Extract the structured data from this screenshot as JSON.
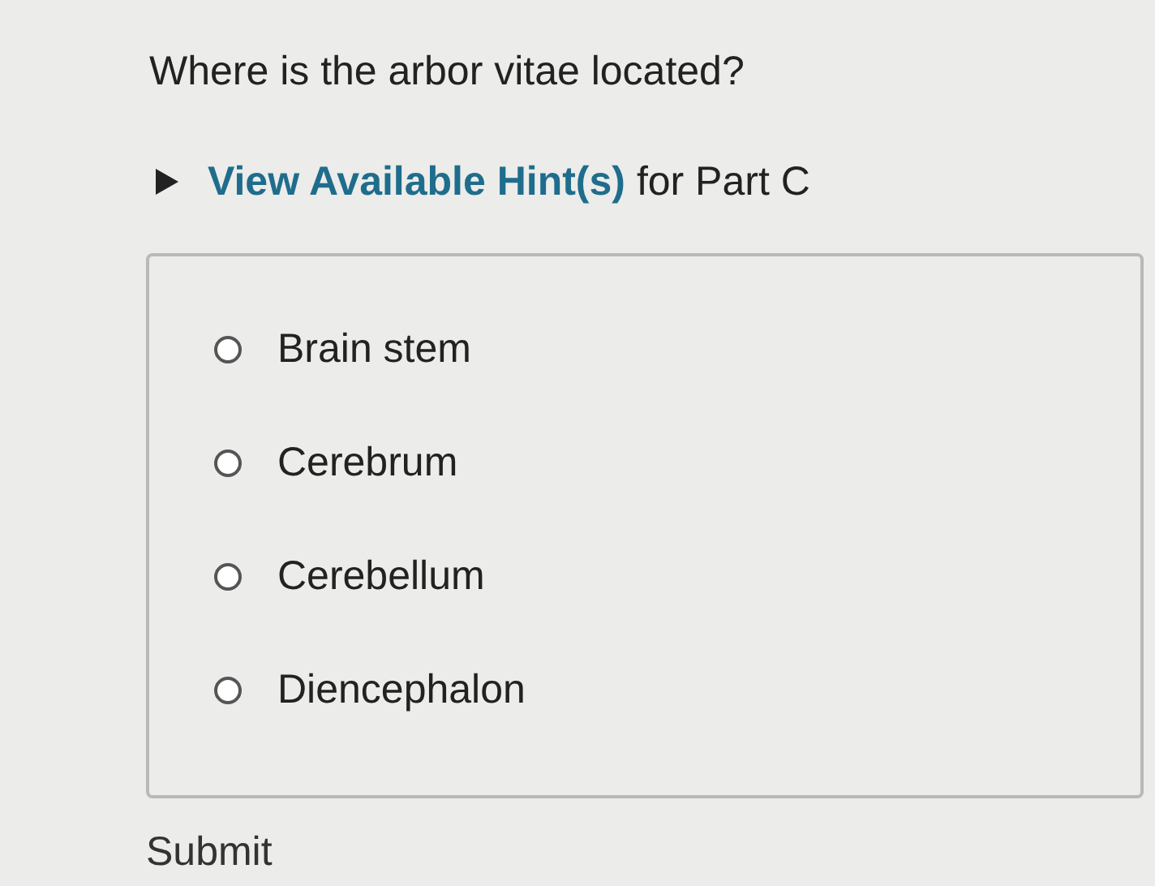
{
  "question": "Where is the arbor vitae located?",
  "hint": {
    "link": "View Available Hint(s)",
    "rest": "for Part C",
    "expanded": false
  },
  "options": [
    {
      "label": "Brain stem",
      "selected": false
    },
    {
      "label": "Cerebrum",
      "selected": false
    },
    {
      "label": "Cerebellum",
      "selected": false
    },
    {
      "label": "Diencephalon",
      "selected": false
    }
  ],
  "submit": "Submit"
}
